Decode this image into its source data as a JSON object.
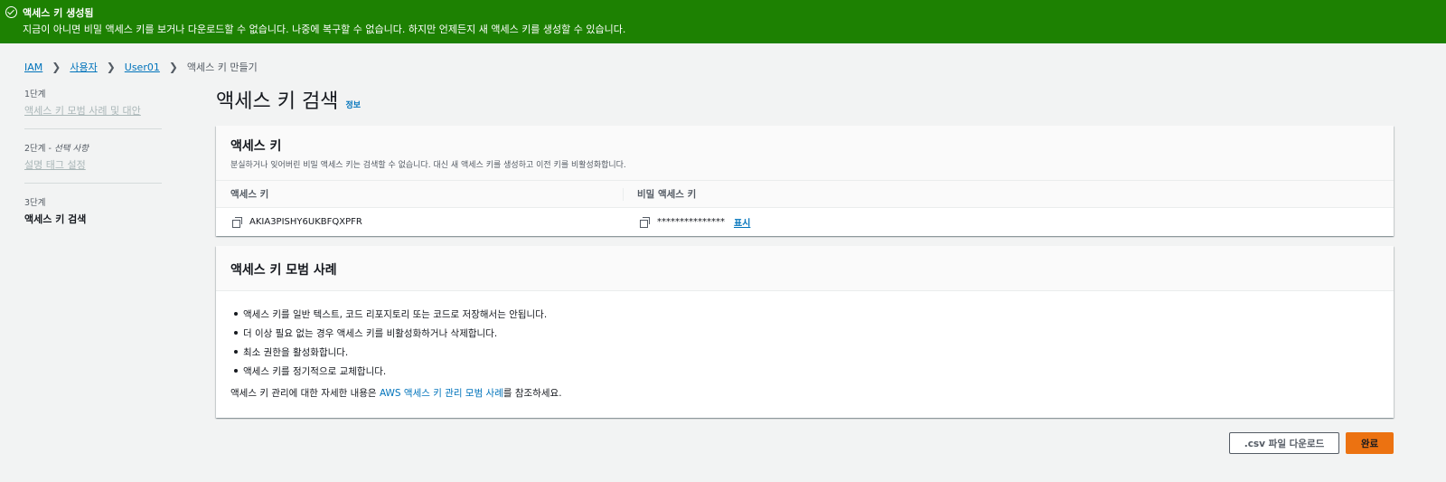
{
  "banner": {
    "title": "액세스 키 생성됨",
    "message": "지금이 아니면 비밀 액세스 키를 보거나 다운로드할 수 없습니다. 나중에 복구할 수 없습니다. 하지만 언제든지 새 액세스 키를 생성할 수 있습니다.",
    "color": "#1d8102"
  },
  "breadcrumb": [
    "IAM",
    "사용자",
    "User01",
    "액세스 키 만들기"
  ],
  "steps": [
    {
      "num": "1단계",
      "optional": "",
      "label": "액세스 키 모범 사례 및 대안"
    },
    {
      "num": "2단계 - ",
      "optional": "선택 사항",
      "label": "설명 태그 설정"
    },
    {
      "num": "3단계",
      "optional": "",
      "label": "액세스 키 검색"
    }
  ],
  "page": {
    "title": "액세스 키 검색",
    "info": "정보"
  },
  "access_key_panel": {
    "title": "액세스 키",
    "description": "분실하거나 잊어버린 비밀 액세스 키는 검색할 수 없습니다. 대신 새 액세스 키를 생성하고 이전 키를 비활성화합니다.",
    "col_access_key": "액세스 키",
    "col_secret_key": "비밀 액세스 키",
    "access_key": "AKIA3PISHY6UKBFQXPFR",
    "secret_key": "***************",
    "show_label": "표시"
  },
  "best_practices": {
    "title": "액세스 키 모범 사례",
    "items": [
      "액세스 키를 일반 텍스트, 코드 리포지토리 또는 코드로 저장해서는 안됩니다.",
      "더 이상 필요 없는 경우 액세스 키를 비활성화하거나 삭제합니다.",
      "최소 권한을 활성화합니다.",
      "액세스 키를 정기적으로 교체합니다."
    ],
    "footer_prefix": "액세스 키 관리에 대한 자세한 내용은 ",
    "footer_link": "AWS 액세스 키 관리 모범 사례",
    "footer_suffix": "를 참조하세요."
  },
  "buttons": {
    "download_csv": ".csv 파일 다운로드",
    "done": "완료"
  },
  "colors": {
    "accent": "#ec7211",
    "link": "#0073bb",
    "success": "#1d8102"
  }
}
